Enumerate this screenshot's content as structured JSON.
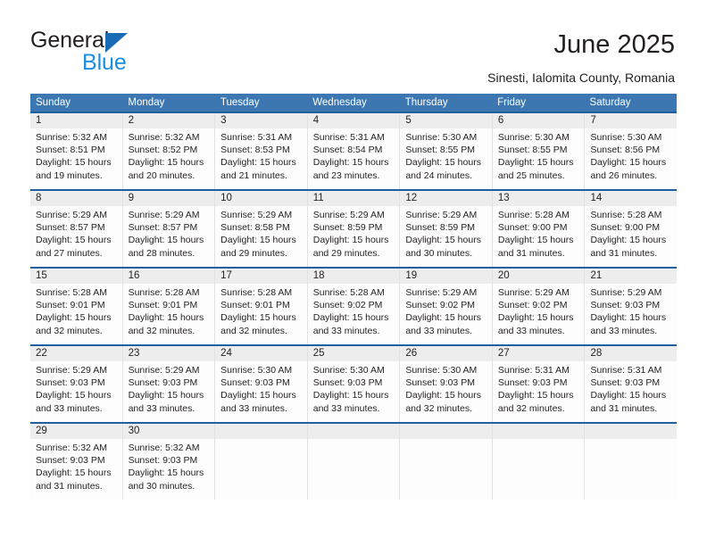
{
  "brand": {
    "name_primary": "General",
    "name_secondary": "Blue",
    "accent_blue": "#1a6bb5",
    "light_blue": "#1a8fe0"
  },
  "header": {
    "title": "June 2025",
    "subtitle": "Sinesti, Ialomita County, Romania"
  },
  "calendar": {
    "header_bg": "#3c77b2",
    "row_border": "#1e5fa0",
    "daynum_bg": "#ededed",
    "weekdays": [
      "Sunday",
      "Monday",
      "Tuesday",
      "Wednesday",
      "Thursday",
      "Friday",
      "Saturday"
    ],
    "weeks": [
      [
        {
          "day": "1",
          "sunrise": "Sunrise: 5:32 AM",
          "sunset": "Sunset: 8:51 PM",
          "daylight1": "Daylight: 15 hours",
          "daylight2": "and 19 minutes."
        },
        {
          "day": "2",
          "sunrise": "Sunrise: 5:32 AM",
          "sunset": "Sunset: 8:52 PM",
          "daylight1": "Daylight: 15 hours",
          "daylight2": "and 20 minutes."
        },
        {
          "day": "3",
          "sunrise": "Sunrise: 5:31 AM",
          "sunset": "Sunset: 8:53 PM",
          "daylight1": "Daylight: 15 hours",
          "daylight2": "and 21 minutes."
        },
        {
          "day": "4",
          "sunrise": "Sunrise: 5:31 AM",
          "sunset": "Sunset: 8:54 PM",
          "daylight1": "Daylight: 15 hours",
          "daylight2": "and 23 minutes."
        },
        {
          "day": "5",
          "sunrise": "Sunrise: 5:30 AM",
          "sunset": "Sunset: 8:55 PM",
          "daylight1": "Daylight: 15 hours",
          "daylight2": "and 24 minutes."
        },
        {
          "day": "6",
          "sunrise": "Sunrise: 5:30 AM",
          "sunset": "Sunset: 8:55 PM",
          "daylight1": "Daylight: 15 hours",
          "daylight2": "and 25 minutes."
        },
        {
          "day": "7",
          "sunrise": "Sunrise: 5:30 AM",
          "sunset": "Sunset: 8:56 PM",
          "daylight1": "Daylight: 15 hours",
          "daylight2": "and 26 minutes."
        }
      ],
      [
        {
          "day": "8",
          "sunrise": "Sunrise: 5:29 AM",
          "sunset": "Sunset: 8:57 PM",
          "daylight1": "Daylight: 15 hours",
          "daylight2": "and 27 minutes."
        },
        {
          "day": "9",
          "sunrise": "Sunrise: 5:29 AM",
          "sunset": "Sunset: 8:57 PM",
          "daylight1": "Daylight: 15 hours",
          "daylight2": "and 28 minutes."
        },
        {
          "day": "10",
          "sunrise": "Sunrise: 5:29 AM",
          "sunset": "Sunset: 8:58 PM",
          "daylight1": "Daylight: 15 hours",
          "daylight2": "and 29 minutes."
        },
        {
          "day": "11",
          "sunrise": "Sunrise: 5:29 AM",
          "sunset": "Sunset: 8:59 PM",
          "daylight1": "Daylight: 15 hours",
          "daylight2": "and 29 minutes."
        },
        {
          "day": "12",
          "sunrise": "Sunrise: 5:29 AM",
          "sunset": "Sunset: 8:59 PM",
          "daylight1": "Daylight: 15 hours",
          "daylight2": "and 30 minutes."
        },
        {
          "day": "13",
          "sunrise": "Sunrise: 5:28 AM",
          "sunset": "Sunset: 9:00 PM",
          "daylight1": "Daylight: 15 hours",
          "daylight2": "and 31 minutes."
        },
        {
          "day": "14",
          "sunrise": "Sunrise: 5:28 AM",
          "sunset": "Sunset: 9:00 PM",
          "daylight1": "Daylight: 15 hours",
          "daylight2": "and 31 minutes."
        }
      ],
      [
        {
          "day": "15",
          "sunrise": "Sunrise: 5:28 AM",
          "sunset": "Sunset: 9:01 PM",
          "daylight1": "Daylight: 15 hours",
          "daylight2": "and 32 minutes."
        },
        {
          "day": "16",
          "sunrise": "Sunrise: 5:28 AM",
          "sunset": "Sunset: 9:01 PM",
          "daylight1": "Daylight: 15 hours",
          "daylight2": "and 32 minutes."
        },
        {
          "day": "17",
          "sunrise": "Sunrise: 5:28 AM",
          "sunset": "Sunset: 9:01 PM",
          "daylight1": "Daylight: 15 hours",
          "daylight2": "and 32 minutes."
        },
        {
          "day": "18",
          "sunrise": "Sunrise: 5:28 AM",
          "sunset": "Sunset: 9:02 PM",
          "daylight1": "Daylight: 15 hours",
          "daylight2": "and 33 minutes."
        },
        {
          "day": "19",
          "sunrise": "Sunrise: 5:29 AM",
          "sunset": "Sunset: 9:02 PM",
          "daylight1": "Daylight: 15 hours",
          "daylight2": "and 33 minutes."
        },
        {
          "day": "20",
          "sunrise": "Sunrise: 5:29 AM",
          "sunset": "Sunset: 9:02 PM",
          "daylight1": "Daylight: 15 hours",
          "daylight2": "and 33 minutes."
        },
        {
          "day": "21",
          "sunrise": "Sunrise: 5:29 AM",
          "sunset": "Sunset: 9:03 PM",
          "daylight1": "Daylight: 15 hours",
          "daylight2": "and 33 minutes."
        }
      ],
      [
        {
          "day": "22",
          "sunrise": "Sunrise: 5:29 AM",
          "sunset": "Sunset: 9:03 PM",
          "daylight1": "Daylight: 15 hours",
          "daylight2": "and 33 minutes."
        },
        {
          "day": "23",
          "sunrise": "Sunrise: 5:29 AM",
          "sunset": "Sunset: 9:03 PM",
          "daylight1": "Daylight: 15 hours",
          "daylight2": "and 33 minutes."
        },
        {
          "day": "24",
          "sunrise": "Sunrise: 5:30 AM",
          "sunset": "Sunset: 9:03 PM",
          "daylight1": "Daylight: 15 hours",
          "daylight2": "and 33 minutes."
        },
        {
          "day": "25",
          "sunrise": "Sunrise: 5:30 AM",
          "sunset": "Sunset: 9:03 PM",
          "daylight1": "Daylight: 15 hours",
          "daylight2": "and 33 minutes."
        },
        {
          "day": "26",
          "sunrise": "Sunrise: 5:30 AM",
          "sunset": "Sunset: 9:03 PM",
          "daylight1": "Daylight: 15 hours",
          "daylight2": "and 32 minutes."
        },
        {
          "day": "27",
          "sunrise": "Sunrise: 5:31 AM",
          "sunset": "Sunset: 9:03 PM",
          "daylight1": "Daylight: 15 hours",
          "daylight2": "and 32 minutes."
        },
        {
          "day": "28",
          "sunrise": "Sunrise: 5:31 AM",
          "sunset": "Sunset: 9:03 PM",
          "daylight1": "Daylight: 15 hours",
          "daylight2": "and 31 minutes."
        }
      ],
      [
        {
          "day": "29",
          "sunrise": "Sunrise: 5:32 AM",
          "sunset": "Sunset: 9:03 PM",
          "daylight1": "Daylight: 15 hours",
          "daylight2": "and 31 minutes."
        },
        {
          "day": "30",
          "sunrise": "Sunrise: 5:32 AM",
          "sunset": "Sunset: 9:03 PM",
          "daylight1": "Daylight: 15 hours",
          "daylight2": "and 30 minutes."
        },
        {
          "day": "",
          "sunrise": "",
          "sunset": "",
          "daylight1": "",
          "daylight2": ""
        },
        {
          "day": "",
          "sunrise": "",
          "sunset": "",
          "daylight1": "",
          "daylight2": ""
        },
        {
          "day": "",
          "sunrise": "",
          "sunset": "",
          "daylight1": "",
          "daylight2": ""
        },
        {
          "day": "",
          "sunrise": "",
          "sunset": "",
          "daylight1": "",
          "daylight2": ""
        },
        {
          "day": "",
          "sunrise": "",
          "sunset": "",
          "daylight1": "",
          "daylight2": ""
        }
      ]
    ]
  }
}
